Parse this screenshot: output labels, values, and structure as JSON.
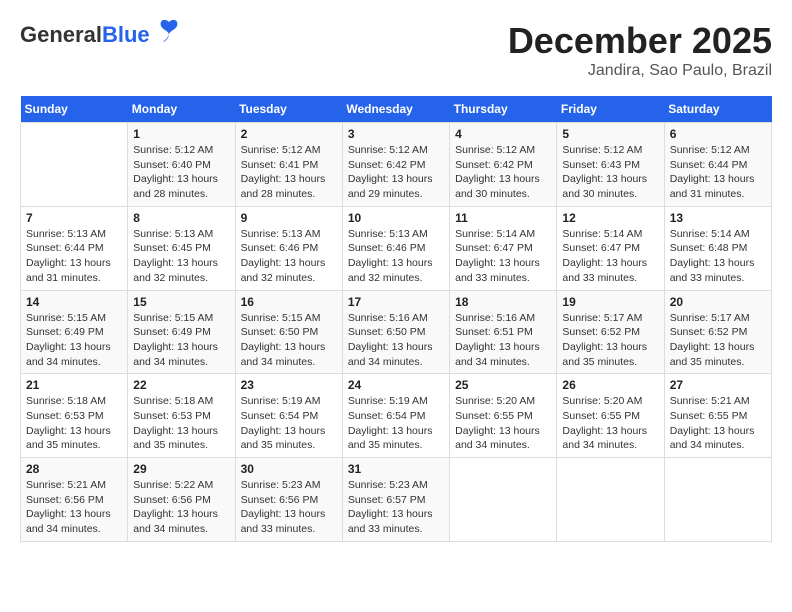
{
  "header": {
    "logo_general": "General",
    "logo_blue": "Blue",
    "month": "December 2025",
    "location": "Jandira, Sao Paulo, Brazil"
  },
  "days_of_week": [
    "Sunday",
    "Monday",
    "Tuesday",
    "Wednesday",
    "Thursday",
    "Friday",
    "Saturday"
  ],
  "weeks": [
    [
      {
        "day": "",
        "info": ""
      },
      {
        "day": "1",
        "info": "Sunrise: 5:12 AM\nSunset: 6:40 PM\nDaylight: 13 hours\nand 28 minutes."
      },
      {
        "day": "2",
        "info": "Sunrise: 5:12 AM\nSunset: 6:41 PM\nDaylight: 13 hours\nand 28 minutes."
      },
      {
        "day": "3",
        "info": "Sunrise: 5:12 AM\nSunset: 6:42 PM\nDaylight: 13 hours\nand 29 minutes."
      },
      {
        "day": "4",
        "info": "Sunrise: 5:12 AM\nSunset: 6:42 PM\nDaylight: 13 hours\nand 30 minutes."
      },
      {
        "day": "5",
        "info": "Sunrise: 5:12 AM\nSunset: 6:43 PM\nDaylight: 13 hours\nand 30 minutes."
      },
      {
        "day": "6",
        "info": "Sunrise: 5:12 AM\nSunset: 6:44 PM\nDaylight: 13 hours\nand 31 minutes."
      }
    ],
    [
      {
        "day": "7",
        "info": "Sunrise: 5:13 AM\nSunset: 6:44 PM\nDaylight: 13 hours\nand 31 minutes."
      },
      {
        "day": "8",
        "info": "Sunrise: 5:13 AM\nSunset: 6:45 PM\nDaylight: 13 hours\nand 32 minutes."
      },
      {
        "day": "9",
        "info": "Sunrise: 5:13 AM\nSunset: 6:46 PM\nDaylight: 13 hours\nand 32 minutes."
      },
      {
        "day": "10",
        "info": "Sunrise: 5:13 AM\nSunset: 6:46 PM\nDaylight: 13 hours\nand 32 minutes."
      },
      {
        "day": "11",
        "info": "Sunrise: 5:14 AM\nSunset: 6:47 PM\nDaylight: 13 hours\nand 33 minutes."
      },
      {
        "day": "12",
        "info": "Sunrise: 5:14 AM\nSunset: 6:47 PM\nDaylight: 13 hours\nand 33 minutes."
      },
      {
        "day": "13",
        "info": "Sunrise: 5:14 AM\nSunset: 6:48 PM\nDaylight: 13 hours\nand 33 minutes."
      }
    ],
    [
      {
        "day": "14",
        "info": "Sunrise: 5:15 AM\nSunset: 6:49 PM\nDaylight: 13 hours\nand 34 minutes."
      },
      {
        "day": "15",
        "info": "Sunrise: 5:15 AM\nSunset: 6:49 PM\nDaylight: 13 hours\nand 34 minutes."
      },
      {
        "day": "16",
        "info": "Sunrise: 5:15 AM\nSunset: 6:50 PM\nDaylight: 13 hours\nand 34 minutes."
      },
      {
        "day": "17",
        "info": "Sunrise: 5:16 AM\nSunset: 6:50 PM\nDaylight: 13 hours\nand 34 minutes."
      },
      {
        "day": "18",
        "info": "Sunrise: 5:16 AM\nSunset: 6:51 PM\nDaylight: 13 hours\nand 34 minutes."
      },
      {
        "day": "19",
        "info": "Sunrise: 5:17 AM\nSunset: 6:52 PM\nDaylight: 13 hours\nand 35 minutes."
      },
      {
        "day": "20",
        "info": "Sunrise: 5:17 AM\nSunset: 6:52 PM\nDaylight: 13 hours\nand 35 minutes."
      }
    ],
    [
      {
        "day": "21",
        "info": "Sunrise: 5:18 AM\nSunset: 6:53 PM\nDaylight: 13 hours\nand 35 minutes."
      },
      {
        "day": "22",
        "info": "Sunrise: 5:18 AM\nSunset: 6:53 PM\nDaylight: 13 hours\nand 35 minutes."
      },
      {
        "day": "23",
        "info": "Sunrise: 5:19 AM\nSunset: 6:54 PM\nDaylight: 13 hours\nand 35 minutes."
      },
      {
        "day": "24",
        "info": "Sunrise: 5:19 AM\nSunset: 6:54 PM\nDaylight: 13 hours\nand 35 minutes."
      },
      {
        "day": "25",
        "info": "Sunrise: 5:20 AM\nSunset: 6:55 PM\nDaylight: 13 hours\nand 34 minutes."
      },
      {
        "day": "26",
        "info": "Sunrise: 5:20 AM\nSunset: 6:55 PM\nDaylight: 13 hours\nand 34 minutes."
      },
      {
        "day": "27",
        "info": "Sunrise: 5:21 AM\nSunset: 6:55 PM\nDaylight: 13 hours\nand 34 minutes."
      }
    ],
    [
      {
        "day": "28",
        "info": "Sunrise: 5:21 AM\nSunset: 6:56 PM\nDaylight: 13 hours\nand 34 minutes."
      },
      {
        "day": "29",
        "info": "Sunrise: 5:22 AM\nSunset: 6:56 PM\nDaylight: 13 hours\nand 34 minutes."
      },
      {
        "day": "30",
        "info": "Sunrise: 5:23 AM\nSunset: 6:56 PM\nDaylight: 13 hours\nand 33 minutes."
      },
      {
        "day": "31",
        "info": "Sunrise: 5:23 AM\nSunset: 6:57 PM\nDaylight: 13 hours\nand 33 minutes."
      },
      {
        "day": "",
        "info": ""
      },
      {
        "day": "",
        "info": ""
      },
      {
        "day": "",
        "info": ""
      }
    ]
  ]
}
